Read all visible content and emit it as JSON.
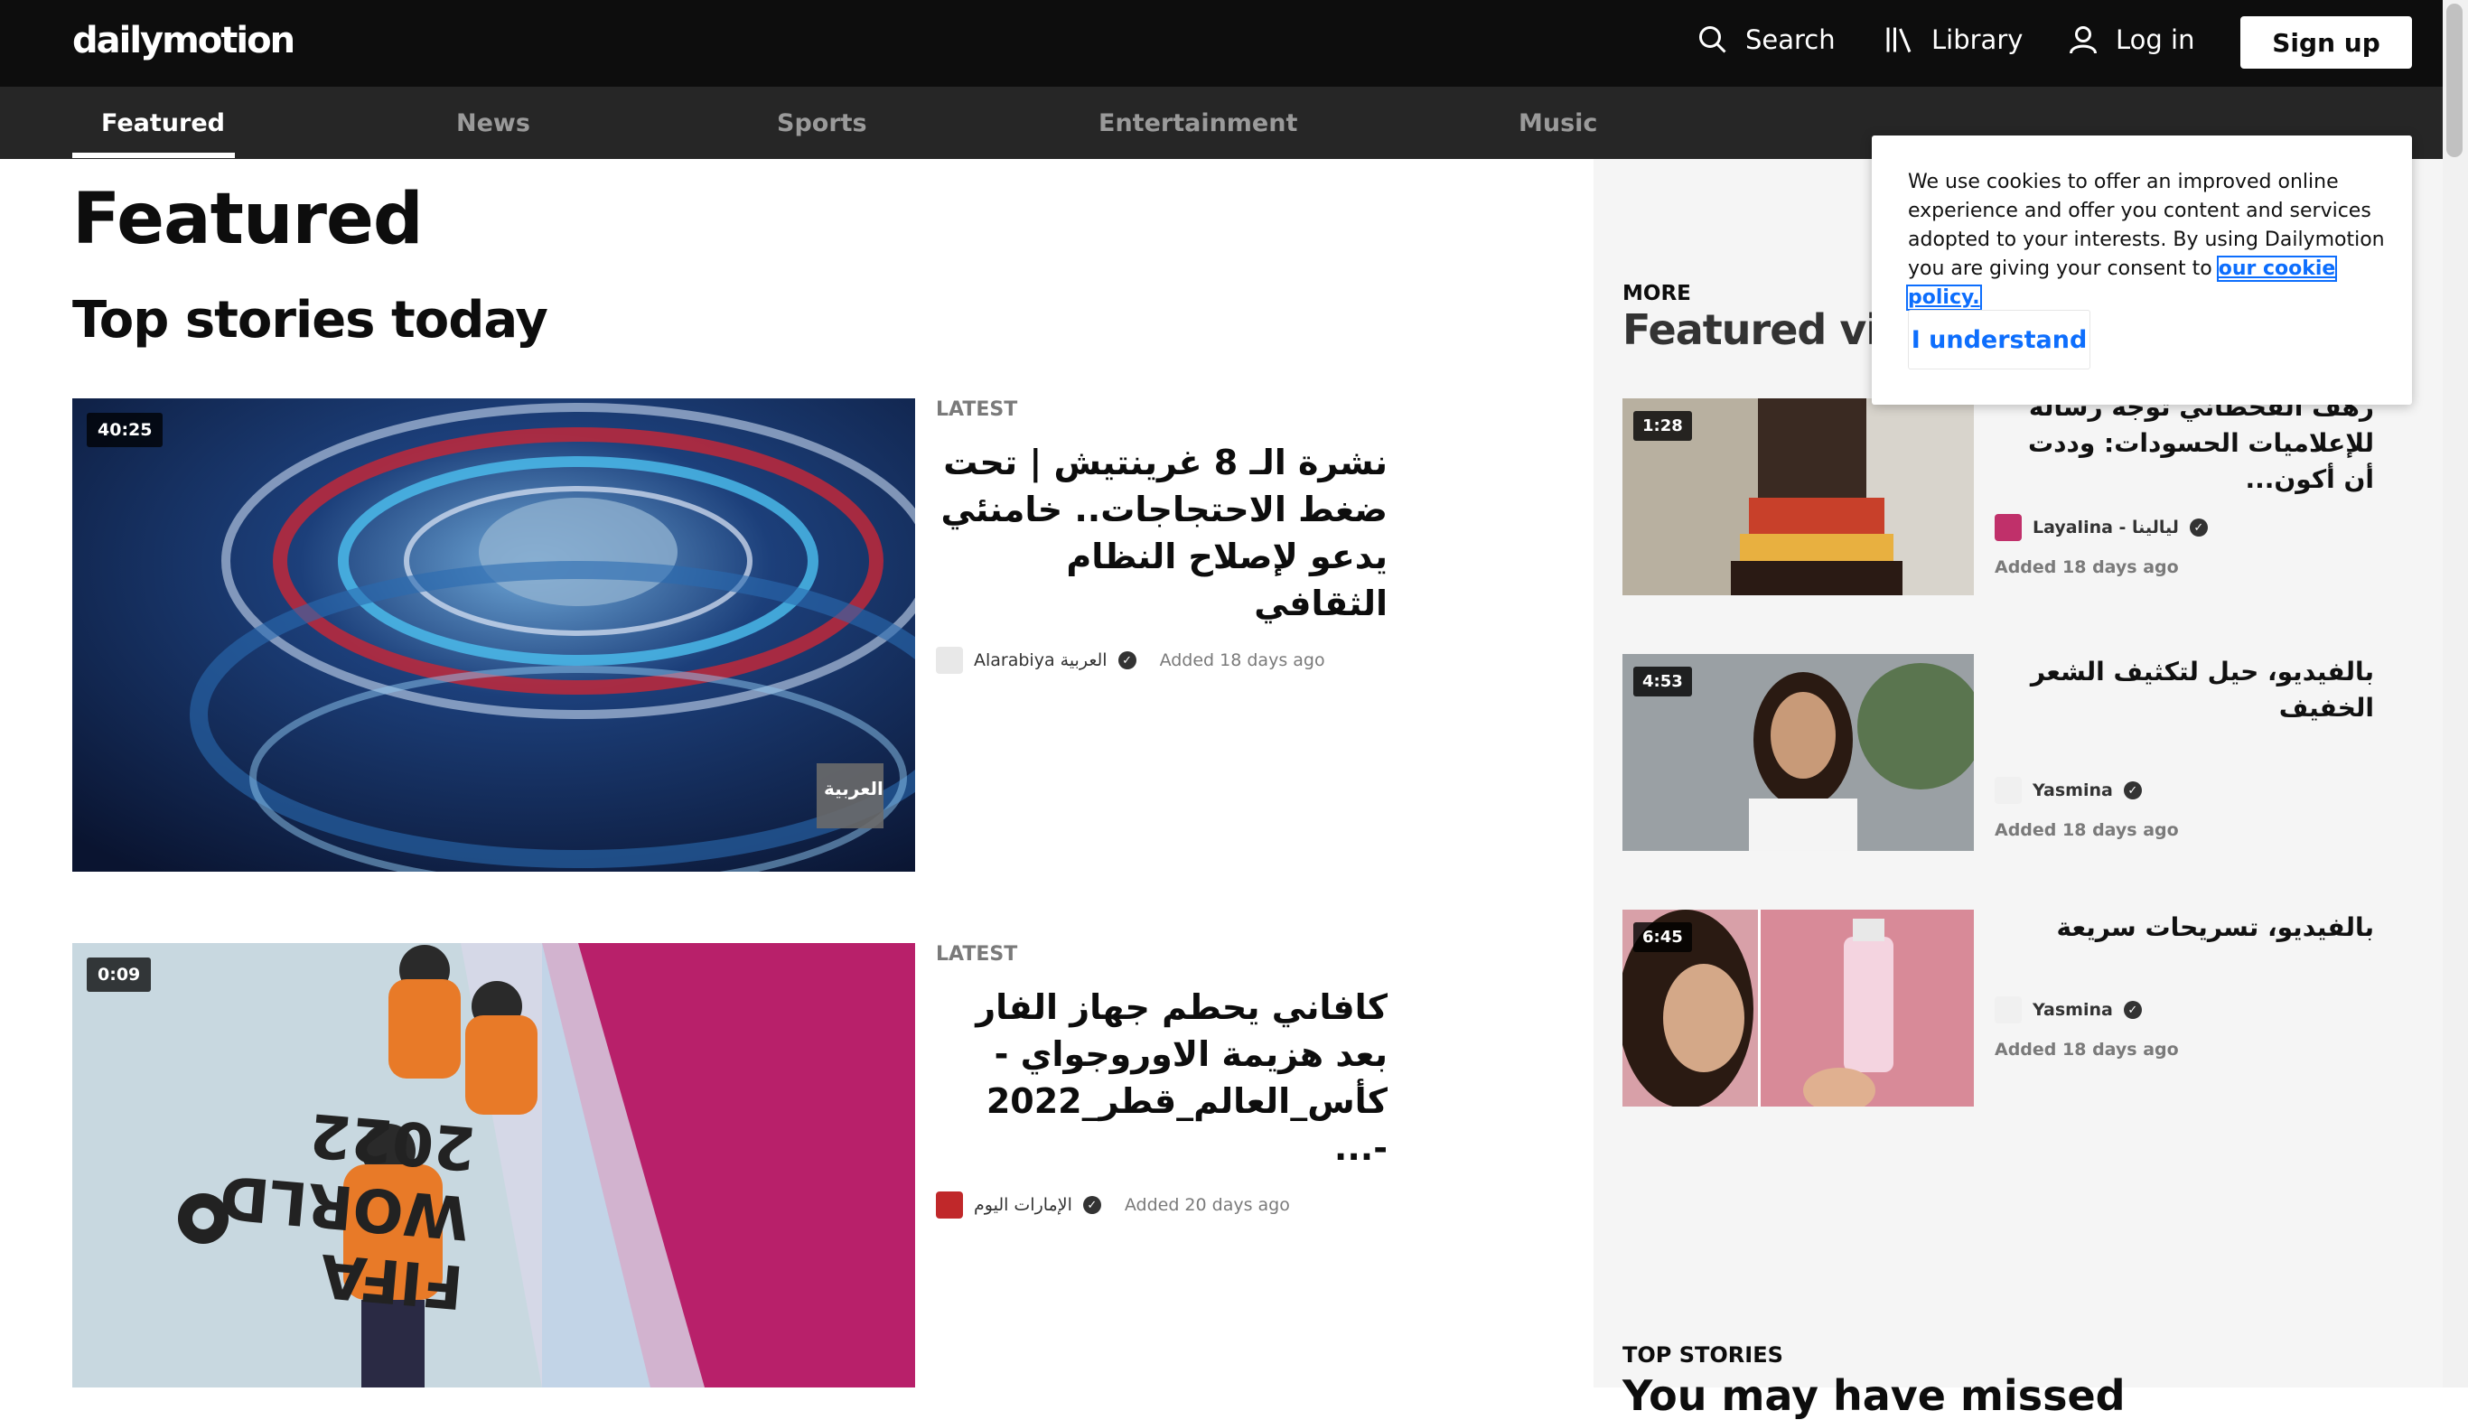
{
  "header": {
    "logo": "dailymotion",
    "search_label": "Search",
    "library_label": "Library",
    "login_label": "Log in",
    "signup_label": "Sign up"
  },
  "nav": {
    "tabs": [
      {
        "label": "Featured",
        "active": true
      },
      {
        "label": "News"
      },
      {
        "label": "Sports"
      },
      {
        "label": "Entertainment"
      },
      {
        "label": "Music"
      }
    ]
  },
  "main": {
    "page_title": "Featured",
    "section_title": "Top stories today",
    "stories": [
      {
        "duration": "40:25",
        "label": "LATEST",
        "title": "نشرة الـ 8 غرينتيش | تحت ضغط الاحتجاجات.. خامنئي يدعو لإصلاح النظام الثقافي",
        "channel": "Alarabiya العربية",
        "added": "Added 18 days ago",
        "thumb_watermark": "العربية"
      },
      {
        "duration": "0:09",
        "label": "LATEST",
        "title": "كافاني يحطم جهاز الفار بعد هزيمة الاوروجواي - كأس_العالم_قطر_2022 -...",
        "channel": "الإمارات اليوم",
        "added": "Added 20 days ago",
        "thumb_text": "FIFA WORLD 2022"
      }
    ]
  },
  "sidebar": {
    "more_label": "MORE",
    "title": "Featured videos",
    "items": [
      {
        "duration": "1:28",
        "title": "رهف القحطاني توجه رسالة للإعلاميات الحسودات: وددت أن أكون...",
        "channel": "Layalina - ليالينا",
        "added": "Added 18 days ago"
      },
      {
        "duration": "4:53",
        "title": "بالفيديو، حيل لتكثيف الشعر الخفيف",
        "channel": "Yasmina",
        "added": "Added 18 days ago"
      },
      {
        "duration": "6:45",
        "title": "بالفيديو، تسريحات سريعة",
        "channel": "Yasmina",
        "added": "Added 18 days ago"
      }
    ],
    "top_stories_label": "TOP STORIES",
    "top_stories_title": "You may have missed"
  },
  "cookie": {
    "text": "We use cookies to offer an improved online experience and offer you content and services adopted to your interests. By using Dailymotion you are giving your consent to",
    "link": "our cookie policy.",
    "button": "I understand"
  },
  "colors": {
    "topbar": "#0d0d0d",
    "navbar": "#262626",
    "accent_link": "#0d6efd"
  }
}
